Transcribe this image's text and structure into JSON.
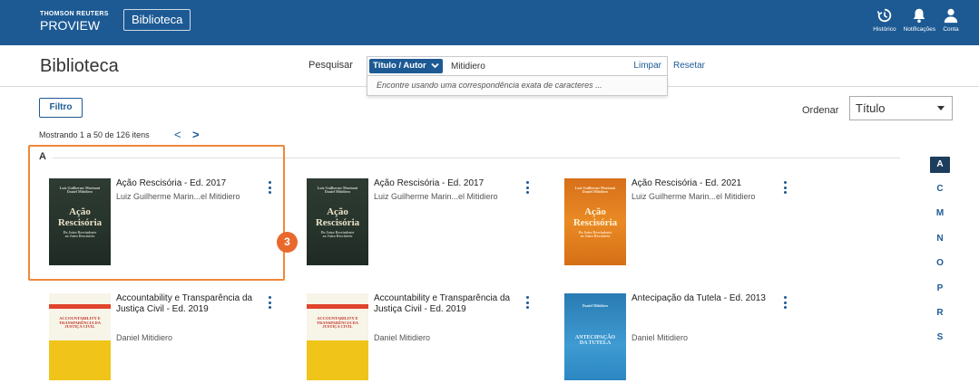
{
  "header": {
    "brand_top": "THOMSON REUTERS",
    "brand_bottom": "PROVIEW",
    "library_button": "Biblioteca",
    "icons": [
      {
        "name": "history-icon",
        "label": "Histórico"
      },
      {
        "name": "bell-icon",
        "label": "Notificações"
      },
      {
        "name": "user-icon",
        "label": "Conta"
      }
    ]
  },
  "toolbar": {
    "page_title": "Biblioteca",
    "search_label": "Pesquisar",
    "search_field": "Título / Autor",
    "search_value": "Mitidiero",
    "clear_label": "Limpar",
    "reset_label": "Resetar",
    "suggestion": "Encontre usando uma correspondência exata de caracteres ..."
  },
  "controls": {
    "filter_label": "Filtro",
    "sort_label": "Ordenar",
    "sort_value": "Título",
    "showing": "Mostrando 1 a 50 de 126 itens",
    "prev": "<",
    "next": ">"
  },
  "group": {
    "letter": "A",
    "step_badge": "3"
  },
  "books": [
    {
      "title": "Ação Rescisória - Ed. 2017",
      "author": "Luiz Guilherme Marin...el Mitidiero",
      "cover": {
        "style": "green",
        "authors": "Luiz Guilherme Marinoni\nDaniel Mitidiero",
        "title": "Ação\nRescisória",
        "subtitle": "Do Juízo Rescindente\nao Juízo Rescisório"
      }
    },
    {
      "title": "Ação Rescisória - Ed. 2017",
      "author": "Luiz Guilherme Marin...el Mitidiero",
      "cover": {
        "style": "green",
        "authors": "Luiz Guilherme Marinoni\nDaniel Mitidiero",
        "title": "Ação\nRescisória",
        "subtitle": "Do Juízo Rescindente\nao Juízo Rescisório"
      }
    },
    {
      "title": "Ação Rescisória - Ed. 2021",
      "author": "Luiz Guilherme Marin...el Mitidiero",
      "cover": {
        "style": "orange",
        "authors": "Luiz Guilherme Marinoni\nDaniel Mitidiero",
        "title": "Ação\nRescisória",
        "subtitle": "Do Juízo Rescindente\nao Juízo Rescisório"
      }
    },
    {
      "title": "Accountability e Transparência da Justiça Civil - Ed. 2019",
      "author": "Daniel Mitidiero",
      "cover": {
        "style": "yellow",
        "authors": "",
        "title": "ACCOUNTABILITY E\nTRANSPARÊNCIA DA\nJUSTIÇA CIVIL",
        "subtitle": ""
      }
    },
    {
      "title": "Accountability e Transparência da Justiça Civil - Ed. 2019",
      "author": "Daniel Mitidiero",
      "cover": {
        "style": "yellow",
        "authors": "",
        "title": "ACCOUNTABILITY E\nTRANSPARÊNCIA DA\nJUSTIÇA CIVIL",
        "subtitle": ""
      }
    },
    {
      "title": "Antecipação da Tutela - Ed. 2013",
      "author": "Daniel Mitidiero",
      "cover": {
        "style": "blue",
        "authors": "Daniel Mitidiero",
        "title": "ANTECIPAÇÃO\nDA TUTELA",
        "subtitle": ""
      }
    }
  ],
  "alphabet": [
    "A",
    "C",
    "M",
    "N",
    "O",
    "P",
    "R",
    "S"
  ],
  "alphabet_active": "A",
  "colors": {
    "header": "#1d5a94",
    "accent": "#e9682c",
    "highlight": "#f0883a"
  }
}
